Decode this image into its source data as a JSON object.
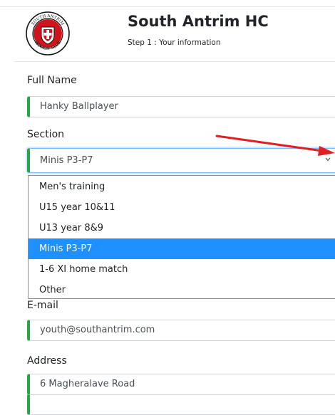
{
  "header": {
    "logo_text_top": "SOUTH ANTRIM",
    "logo_text_bottom": "HOCKEY CLUB",
    "club_name": "South Antrim HC",
    "step_text": "Step 1 : Your information"
  },
  "form": {
    "full_name": {
      "label": "Full Name",
      "value": "Hanky Ballplayer"
    },
    "section": {
      "label": "Section",
      "value": "Minis P3-P7",
      "options": [
        "Men's training",
        "U15 year 10&11",
        "U13 year 8&9",
        "Minis P3-P7",
        "1-6 XI home match",
        "Other"
      ],
      "selected_index": 3
    },
    "email": {
      "label": "E-mail",
      "value": "youth@southantrim.com"
    },
    "address": {
      "label": "Address",
      "value": "6 Magheralave Road"
    }
  },
  "colors": {
    "valid_border": "#28a745",
    "selected_option": "#1e90ff",
    "annotation_arrow": "#e02020",
    "logo_red": "#d0141e"
  },
  "icons": {
    "select_arrow": "chevron-down-icon",
    "annotation": "red-arrow-icon"
  }
}
